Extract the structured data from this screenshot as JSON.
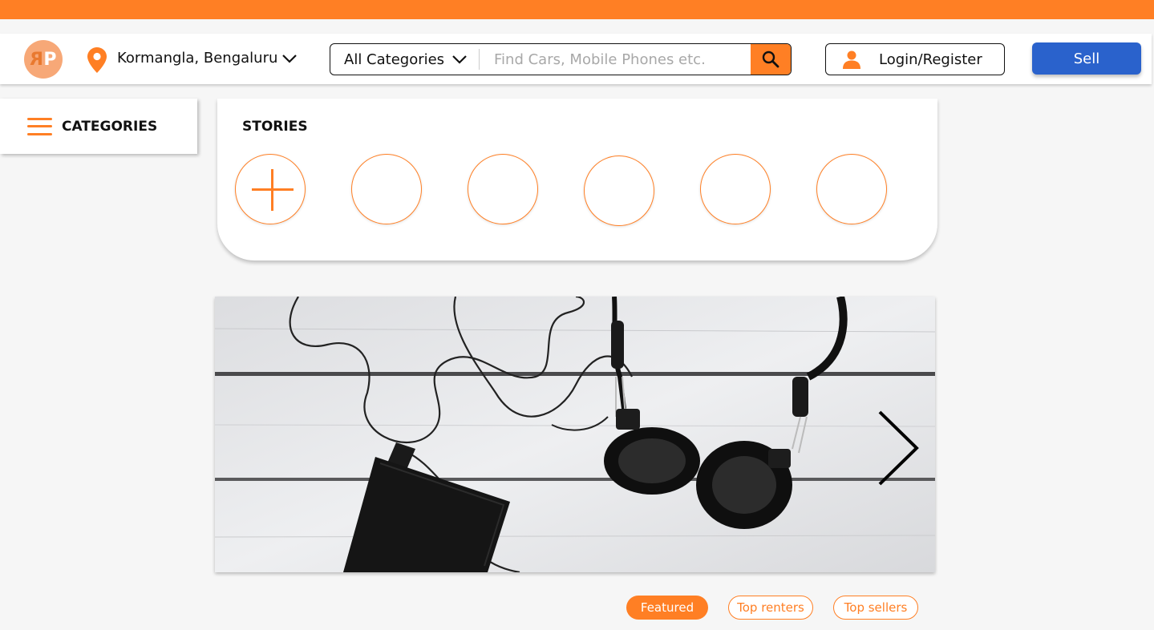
{
  "colors": {
    "accent": "#ff7f24",
    "sell_button": "#2a62cc",
    "background": "#f6f6f6"
  },
  "header": {
    "logo_text": "ЯP",
    "location": "Kormangla, Bengaluru",
    "category_select": "All Categories",
    "search_placeholder": "Find Cars, Mobile Phones etc.",
    "login_label": "Login/Register",
    "sell_label": "Sell"
  },
  "sidebar": {
    "categories_label": "CATEGORIES"
  },
  "stories": {
    "title": "STORIES",
    "count": 6,
    "first_is_add": true
  },
  "banner": {
    "subject": "headphones and phone on white wooden table",
    "has_next_arrow": true
  },
  "tabs": [
    {
      "label": "Featured",
      "active": true
    },
    {
      "label": "Top renters",
      "active": false
    },
    {
      "label": "Top sellers",
      "active": false
    }
  ]
}
